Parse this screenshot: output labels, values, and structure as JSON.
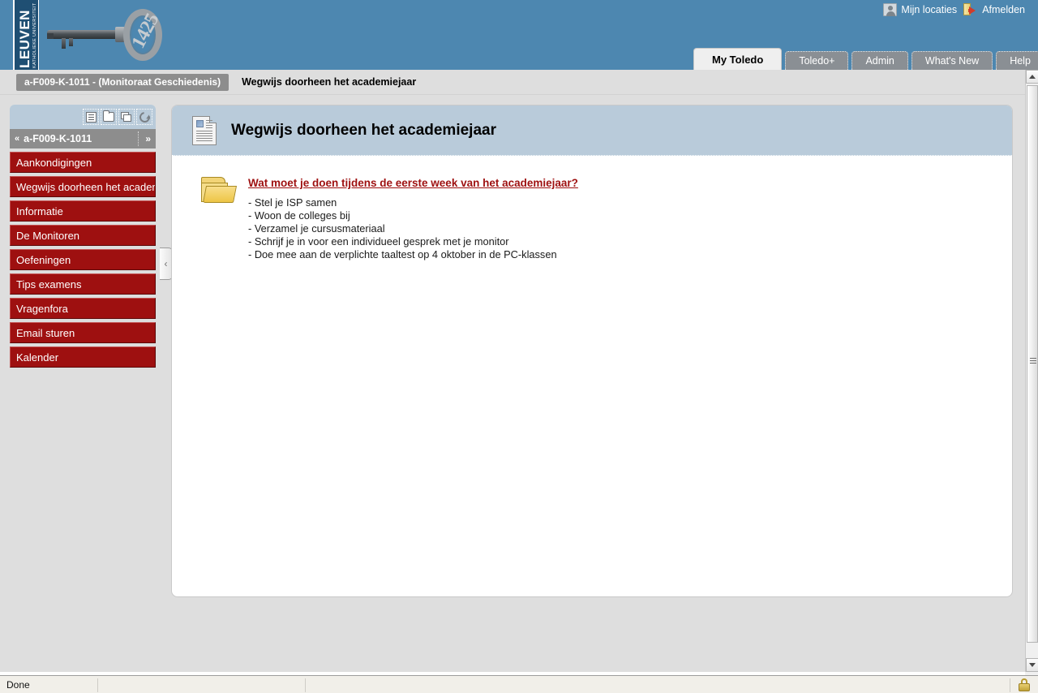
{
  "header": {
    "logo": {
      "university_line1": "KATHOLIEKE UNIVERSITEIT",
      "university_line2": "LEUVEN",
      "key_number": "1425"
    },
    "user_links": [
      {
        "label": "Mijn locaties",
        "icon": "person-icon"
      },
      {
        "label": "Afmelden",
        "icon": "logout-icon"
      }
    ],
    "tabs": [
      {
        "label": "My Toledo",
        "active": true
      },
      {
        "label": "Toledo+",
        "active": false
      },
      {
        "label": "Admin",
        "active": false
      },
      {
        "label": "What's New",
        "active": false
      },
      {
        "label": "Help",
        "active": false
      }
    ]
  },
  "breadcrumb": {
    "course_button": "a-F009-K-1011  - (Monitoraat Geschiedenis)",
    "current_page": "Wegwijs doorheen het academiejaar"
  },
  "sidebar": {
    "tools": [
      {
        "name": "list-view-icon",
        "title": "List view"
      },
      {
        "name": "folder-view-icon",
        "title": "Folder view"
      },
      {
        "name": "window-view-icon",
        "title": "Display view"
      },
      {
        "name": "refresh-icon",
        "title": "Refresh"
      }
    ],
    "header": {
      "collapse_chevron": "«",
      "title": "a-F009-K-1011",
      "expand_chevron": "»"
    },
    "collapse_handle": "‹",
    "items": [
      {
        "label": "Aankondigingen"
      },
      {
        "label": "Wegwijs doorheen het academiejaar"
      },
      {
        "label": "Informatie"
      },
      {
        "label": "De Monitoren"
      },
      {
        "label": "Oefeningen"
      },
      {
        "label": "Tips examens"
      },
      {
        "label": "Vragenfora"
      },
      {
        "label": "Email sturen"
      },
      {
        "label": "Kalender"
      }
    ]
  },
  "content": {
    "title": "Wegwijs doorheen het academiejaar",
    "doc_icon": "document-icon",
    "items": [
      {
        "icon": "folder-icon",
        "link": "Wat moet je doen tijdens de eerste week van het academiejaar?",
        "lines": [
          "- Stel je ISP samen",
          "- Woon de colleges bij",
          "- Verzamel je cursusmateriaal",
          "- Schrijf je in voor een individueel gesprek met je monitor",
          "- Doe mee aan de verplichte taaltest op 4 oktober in de PC-klassen"
        ]
      }
    ]
  },
  "statusbar": {
    "text": "Done",
    "lock_icon": "secure-lock-icon"
  },
  "colors": {
    "header_blue": "#4d87b0",
    "panel_blue": "#b9cbda",
    "menu_red": "#9e1010",
    "page_gray": "#dedede",
    "tab_gray": "#8a8f94"
  }
}
